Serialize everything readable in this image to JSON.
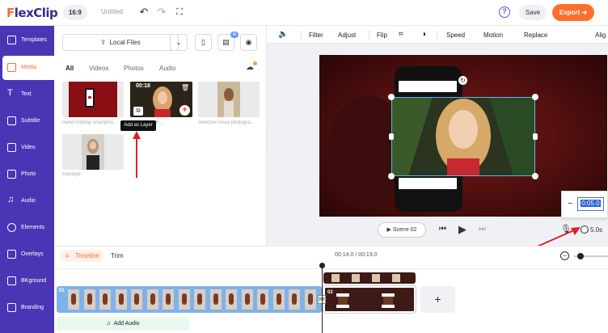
{
  "topbar": {
    "logo_f": "F",
    "logo_rest": "lexClip",
    "ratio": "16:9",
    "title": "Untitled",
    "help": "?",
    "save": "Save",
    "export": "Export"
  },
  "sidebar": {
    "items": [
      {
        "label": "Templates"
      },
      {
        "label": "Media"
      },
      {
        "label": "Text"
      },
      {
        "label": "Subtitle"
      },
      {
        "label": "Video"
      },
      {
        "label": "Photo"
      },
      {
        "label": "Audio"
      },
      {
        "label": "Elements"
      },
      {
        "label": "Overlays"
      },
      {
        "label": "BKground"
      },
      {
        "label": "Branding"
      }
    ]
  },
  "media": {
    "local_files": "Local Files",
    "ai_badge": "AI",
    "tabs": [
      "All",
      "Videos",
      "Photos",
      "Audio"
    ],
    "items": [
      {
        "caption": "Hand holding Smartpho..."
      },
      {
        "caption": "...ion girl with ...",
        "duration": "00:18"
      },
      {
        "caption": "selective focus photogra..."
      },
      {
        "caption": "Mandiye"
      }
    ],
    "tooltip": "Add as Layer"
  },
  "editbar": {
    "filter": "Filter",
    "adjust": "Adjust",
    "flip": "Flip",
    "speed": "Speed",
    "motion": "Motion",
    "replace": "Replace",
    "align": "Alig"
  },
  "player": {
    "scene": "Scene 02",
    "duration_value": "0:05.0",
    "duration_label": "5.0s"
  },
  "timeline": {
    "tab": "Timeline",
    "trim": "Trim",
    "time": "00:14.0 / 00:19.0",
    "clip1_index": "01",
    "clip2_index": "02",
    "add_audio": "Add Audio"
  },
  "colors": {
    "brand_purple": "#4a35b5",
    "accent_orange": "#ff6e2b",
    "annotation_red": "#e0202a"
  }
}
